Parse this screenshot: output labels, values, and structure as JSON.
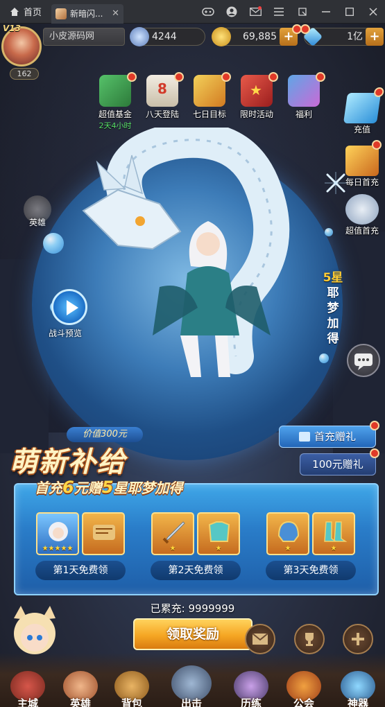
{
  "chrome": {
    "home_label": "首页",
    "tab_title": "新暗闪...",
    "tab_close": "✕",
    "icons": [
      "gamepad-icon",
      "user-icon",
      "mail-icon",
      "menu-icon",
      "restore-icon",
      "minimize-icon",
      "maximize-icon",
      "close-icon"
    ]
  },
  "player": {
    "vip": "V13",
    "level": "162",
    "name": "小皮源码网"
  },
  "resources": {
    "power": "4244",
    "gold": "69,885",
    "diamonds": "1亿"
  },
  "events": [
    {
      "label": "超值基金",
      "sub": "2天4小时"
    },
    {
      "label": "八天登陆",
      "sub": ""
    },
    {
      "label": "七日目标",
      "sub": ""
    },
    {
      "label": "限时活动",
      "sub": ""
    },
    {
      "label": "福利",
      "sub": ""
    }
  ],
  "side": {
    "recharge": "充值",
    "daily": "每日首充",
    "value": "超值首充",
    "hero_left": "英雄"
  },
  "popup": {
    "preview_label": "战斗预览",
    "vertical_star": "5星",
    "vertical_text": [
      "耶",
      "梦",
      "加",
      "得"
    ],
    "price_tag": "价值300元",
    "title": "萌新补给",
    "subtitle_pre": "首充",
    "subtitle_num1": "6",
    "subtitle_mid": "元赠",
    "subtitle_num2": "5",
    "subtitle_end": "星耶梦加得",
    "gift_first": "首充赠礼",
    "gift_100": "100元赠礼",
    "days": [
      {
        "label": "第1天免费领",
        "items": [
          "hero-portrait",
          "scroll-item"
        ]
      },
      {
        "label": "第2天免费领",
        "items": [
          "dagger-item",
          "armor-item"
        ]
      },
      {
        "label": "第3天免费领",
        "items": [
          "helmet-item",
          "boots-item"
        ]
      }
    ],
    "total_label": "已累充: 9999999",
    "claim_label": "领取奖励"
  },
  "nav": [
    {
      "label": "主城"
    },
    {
      "label": "英雄"
    },
    {
      "label": "背包"
    },
    {
      "label": "出击"
    },
    {
      "label": "历练"
    },
    {
      "label": "公会"
    },
    {
      "label": "神器"
    }
  ],
  "colors": {
    "accent_gold": "#f5a623",
    "panel_blue": "#2a7dc9",
    "badge_red": "#e03a28"
  }
}
